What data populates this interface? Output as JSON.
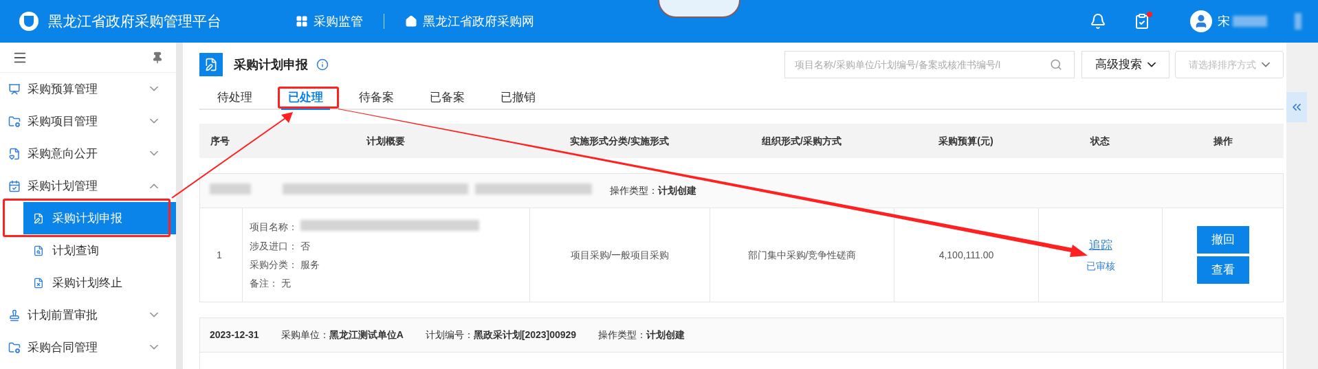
{
  "header": {
    "title": "黑龙江省政府采购管理平台",
    "nav": [
      {
        "label": "采购监管"
      },
      {
        "label": "黑龙江省政府采购网"
      }
    ],
    "task_badge": true,
    "user": "宋"
  },
  "sidebar": {
    "items": [
      {
        "label": "采购预算管理",
        "expanded": false
      },
      {
        "label": "采购项目管理",
        "expanded": false
      },
      {
        "label": "采购意向公开",
        "expanded": false
      },
      {
        "label": "采购计划管理",
        "expanded": true,
        "children": [
          {
            "label": "采购计划申报",
            "selected": true
          },
          {
            "label": "计划查询",
            "selected": false
          },
          {
            "label": "采购计划终止",
            "selected": false
          }
        ]
      },
      {
        "label": "计划前置审批",
        "expanded": false
      },
      {
        "label": "采购合同管理",
        "expanded": false
      }
    ]
  },
  "page": {
    "title": "采购计划申报",
    "search": {
      "placeholder": "项目名称/采购单位/计划编号/备案或核准书编号/I"
    },
    "advanced_search": "高级搜索",
    "sort": {
      "placeholder": "请选择排序方式"
    }
  },
  "tabs": [
    {
      "label": "待处理",
      "selected": false
    },
    {
      "label": "已处理",
      "selected": true
    },
    {
      "label": "待备案",
      "selected": false
    },
    {
      "label": "已备案",
      "selected": false
    },
    {
      "label": "已撤销",
      "selected": false
    }
  ],
  "table": {
    "columns": [
      "序号",
      "计划概要",
      "实施形式分类/实施形式",
      "组织形式/采购方式",
      "采购预算(元)",
      "状态",
      "操作"
    ],
    "records": [
      {
        "redacted": true,
        "meta": [
          {
            "label": "操作类型：",
            "value": "计划创建"
          }
        ],
        "row": {
          "index": "1",
          "summary": [
            {
              "label": "项目名称："
            },
            {
              "label": "涉及进口：",
              "value": "否"
            },
            {
              "label": "采购分类：",
              "value": "服务"
            },
            {
              "label": "备注：",
              "value": "无"
            }
          ],
          "form": "项目采购/一般项目采购",
          "method": "部门集中采购/竞争性磋商",
          "budget": "4,100,111.00",
          "track": "追踪",
          "status": "已审核",
          "actions": [
            "撤回",
            "查看"
          ]
        }
      },
      {
        "redacted": false,
        "meta": [
          {
            "value": "2023-12-31"
          },
          {
            "label": "采购单位：",
            "value": "黑龙江测试单位A"
          },
          {
            "label": "计划编号：",
            "value": "黑政采计划[2023]00929"
          },
          {
            "label": "操作类型：",
            "value": "计划创建"
          }
        ]
      }
    ]
  }
}
